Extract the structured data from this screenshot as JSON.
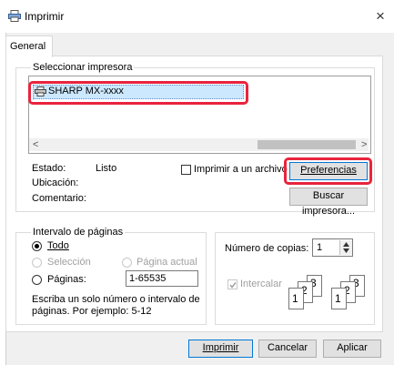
{
  "window": {
    "title": "Imprimir",
    "close_glyph": "×"
  },
  "tabs": [
    {
      "label": "General"
    }
  ],
  "printer_select": {
    "label": "Seleccionar impresora",
    "printers": [
      {
        "name": "SHARP MX-xxxx",
        "icon": "printer-icon"
      }
    ],
    "scroll_left": "<",
    "scroll_right": ">"
  },
  "status": {
    "estado_label": "Estado:",
    "estado_value": "Listo",
    "ubicacion_label": "Ubicación:",
    "comentario_label": "Comentario:",
    "print_to_file_label": "Imprimir a un archivo",
    "preferences_button": "Preferencias",
    "find_printer_button": "Buscar impresora..."
  },
  "page_range": {
    "label": "Intervalo de páginas",
    "todo": "Todo",
    "seleccion": "Selección",
    "pagina_actual": "Página actual",
    "paginas": "Páginas:",
    "paginas_value": "1-65535",
    "hint_line1": "Escriba un solo número o intervalo de",
    "hint_line2": "páginas. Por ejemplo: 5-12"
  },
  "copies": {
    "label": "Número de copias:",
    "value": "1",
    "collate_label": "Intercalar",
    "collate_sets": [
      [
        "1",
        "2",
        "3"
      ],
      [
        "1",
        "2",
        "3"
      ]
    ]
  },
  "footer": {
    "print": "Imprimir",
    "cancel": "Cancelar",
    "apply": "Aplicar"
  },
  "colors": {
    "highlight": "#e8243d",
    "selection": "#cce8ff",
    "button_border": "#0078d7"
  }
}
